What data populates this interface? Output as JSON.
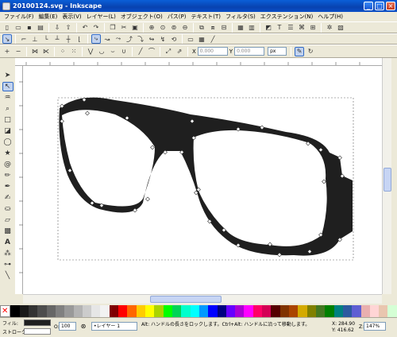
{
  "window": {
    "title": "20100124.svg - Inkscape"
  },
  "menu": [
    "ファイル(F)",
    "編集(E)",
    "表示(V)",
    "レイヤー(L)",
    "オブジェクト(O)",
    "パス(P)",
    "テキスト(T)",
    "フィルタ(S)",
    "エクステンション(N)",
    "ヘルプ(H)"
  ],
  "node_toolbar": {
    "x_value": "0.000",
    "y_value": "0.000",
    "unit": "px"
  },
  "status": {
    "fill_label": "フィル:",
    "stroke_label": "ストローク:",
    "opacity_label": "O:",
    "opacity_value": "100",
    "layer": "•レイヤー 1",
    "message": "Alt: ハンドルの長さをロックします。Ctrl+Alt: ハンドルに沿って移動します。",
    "x_label": "X:",
    "x_value": "284.90",
    "y_label": "Y:",
    "y_value": "416.62",
    "zoom_label": "Z:",
    "zoom_value": "147%"
  },
  "colors": {
    "shape": "#1f1f1f",
    "node": "#ffffff"
  }
}
